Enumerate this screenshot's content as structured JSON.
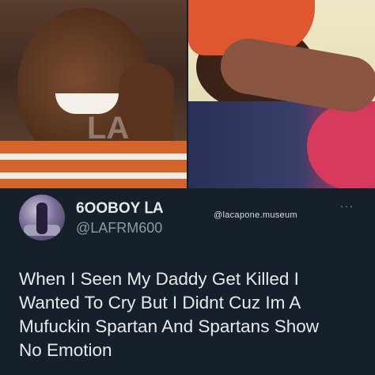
{
  "photos": {
    "left_watermark": "LA",
    "left_alt": "man-laughing-on-phone-photo",
    "right_alt": "person-in-red-bucket-hat-covering-face-photo"
  },
  "tweet": {
    "author_name": "6OOBOY ᒪA",
    "author_handle": "@LAFRM600",
    "source_watermark": "@lacapone.museum",
    "more_icon": "···",
    "text_lines": [
      "When I Seen My Daddy Get Killed I",
      "Wanted To Cry But I Didnt Cuz Im A",
      "Mufuckin Spartan And Spartans Show",
      "No Emotion"
    ]
  },
  "colors": {
    "background": "#15202b",
    "primary_text": "#e7e9ea",
    "secondary_text": "#8b98a5"
  }
}
